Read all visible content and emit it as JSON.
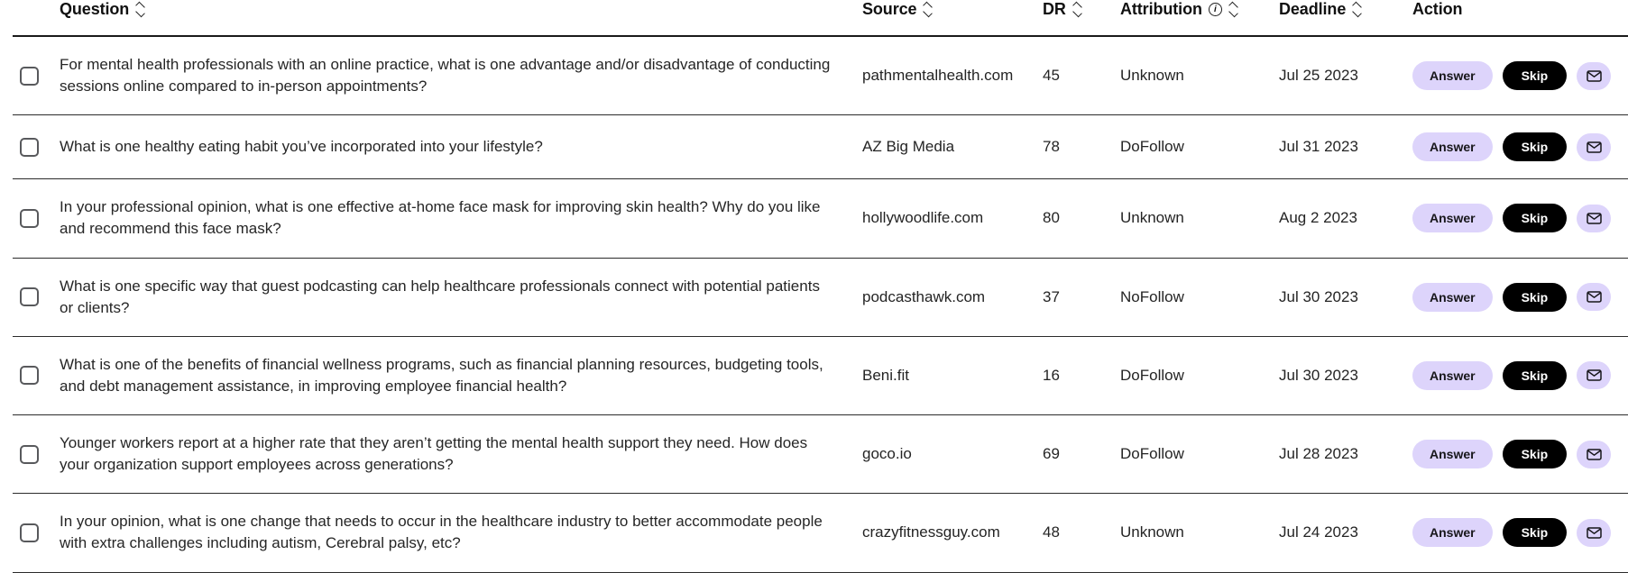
{
  "table": {
    "columns": [
      {
        "key": "select",
        "label": "",
        "sortable": false,
        "info": false
      },
      {
        "key": "question",
        "label": "Question",
        "sortable": true,
        "info": false
      },
      {
        "key": "source",
        "label": "Source",
        "sortable": true,
        "info": false
      },
      {
        "key": "dr",
        "label": "DR",
        "sortable": true,
        "info": false
      },
      {
        "key": "attribution",
        "label": "Attribution",
        "sortable": true,
        "info": true
      },
      {
        "key": "deadline",
        "label": "Deadline",
        "sortable": true,
        "info": false
      },
      {
        "key": "action",
        "label": "Action",
        "sortable": false,
        "info": false
      }
    ],
    "info_glyph": "i",
    "rows": [
      {
        "question": "For mental health professionals with an online practice, what is one advantage and/or disadvantage of conducting sessions online compared to in-person appointments?",
        "source": "pathmentalhealth.com",
        "dr": "45",
        "attribution": "Unknown",
        "deadline": "Jul 25 2023",
        "checked": false
      },
      {
        "question": "What is one healthy eating habit you’ve incorporated into your lifestyle?",
        "source": "AZ Big Media",
        "dr": "78",
        "attribution": "DoFollow",
        "deadline": "Jul 31 2023",
        "checked": false
      },
      {
        "question": "In your professional opinion, what is one effective at-home face mask for improving skin health? Why do you like and recommend this face mask?",
        "source": "hollywoodlife.com",
        "dr": "80",
        "attribution": "Unknown",
        "deadline": "Aug 2 2023",
        "checked": false
      },
      {
        "question": "What is one specific way that guest podcasting can help healthcare professionals connect with potential patients or clients?",
        "source": "podcasthawk.com",
        "dr": "37",
        "attribution": "NoFollow",
        "deadline": "Jul 30 2023",
        "checked": false
      },
      {
        "question": "What is one of the benefits of financial wellness programs, such as financial planning resources, budgeting tools, and debt management assistance, in improving employee financial health?",
        "source": "Beni.fit",
        "dr": "16",
        "attribution": "DoFollow",
        "deadline": "Jul 30 2023",
        "checked": false
      },
      {
        "question": "Younger workers report at a higher rate that they aren’t getting the mental health support they need. How does your organization support employees across generations?",
        "source": "goco.io",
        "dr": "69",
        "attribution": "DoFollow",
        "deadline": "Jul 28 2023",
        "checked": false
      },
      {
        "question": "In your opinion, what is one change that needs to occur in the healthcare industry to better accommodate people with extra challenges including autism, Cerebral palsy, etc?",
        "source": "crazyfitnessguy.com",
        "dr": "48",
        "attribution": "Unknown",
        "deadline": "Jul 24 2023",
        "checked": false
      }
    ]
  },
  "actions": {
    "answer_label": "Answer",
    "skip_label": "Skip",
    "mail_icon": "envelope-icon"
  },
  "colors": {
    "accent_lavender": "#ddd4fb",
    "skip_black": "#000000",
    "text": "#242424",
    "border": "#2b2b2b"
  }
}
